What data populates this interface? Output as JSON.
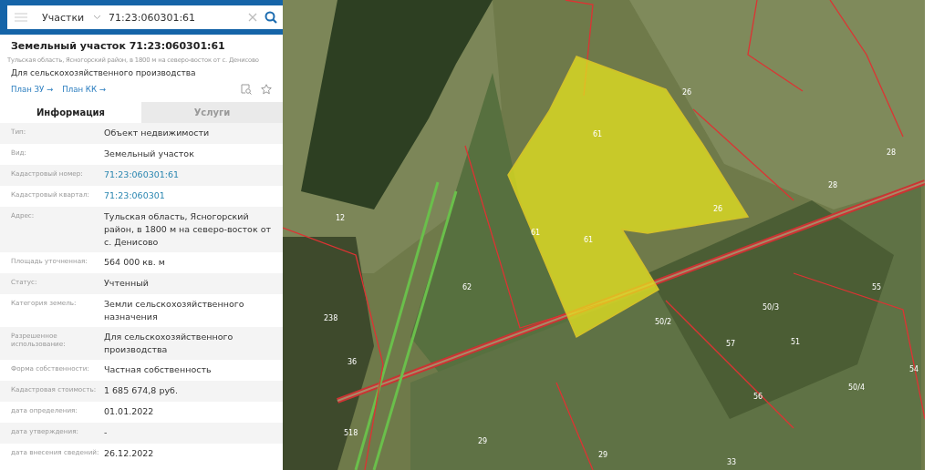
{
  "search": {
    "layer": "Участки",
    "query": "71:23:060301:61"
  },
  "card": {
    "title": "Земельный участок 71:23:060301:61",
    "address": "Тульская область, Ясногорский район, в 1800 м на северо-восток от с. Денисово",
    "purpose": "Для сельскохозяйственного производства",
    "links": [
      "План ЗУ →",
      "План КК →"
    ]
  },
  "tabs": [
    {
      "label": "Информация",
      "selected": true
    },
    {
      "label": "Услуги",
      "selected": false
    }
  ],
  "rows": [
    {
      "label": "Тип:",
      "value": "Объект недвижимости",
      "kind": "text"
    },
    {
      "label": "Вид:",
      "value": "Земельный участок",
      "kind": "text"
    },
    {
      "label": "Кадастровый номер:",
      "value": "71:23:060301:61",
      "kind": "link"
    },
    {
      "label": "Кадастровый квартал:",
      "value": "71:23:060301",
      "kind": "link"
    },
    {
      "label": "Адрес:",
      "value": "Тульская область, Ясногорский район, в 1800 м на северо-восток от с. Денисово",
      "kind": "text"
    },
    {
      "label": "Площадь уточненная:",
      "value": "564 000 кв. м",
      "kind": "text"
    },
    {
      "label": "Статус:",
      "value": "Учтенный",
      "kind": "text"
    },
    {
      "label": "Категория земель:",
      "value": "Земли сельскохозяйственного назначения",
      "kind": "text"
    },
    {
      "label": "Разрешенное использование:",
      "value": "Для сельскохозяйственного производства",
      "kind": "text"
    },
    {
      "label": "Форма собственности:",
      "value": "Частная собственность",
      "kind": "text"
    },
    {
      "label": "Кадастровая стоимость:",
      "value": "1 685 674,8 руб.",
      "kind": "text"
    },
    {
      "label": "дата определения:",
      "value": "01.01.2022",
      "kind": "text"
    },
    {
      "label": "дата утверждения:",
      "value": "-",
      "kind": "text"
    },
    {
      "label": "дата внесения сведений:",
      "value": "26.12.2022",
      "kind": "text"
    }
  ],
  "map": {
    "labels": [
      "61",
      "61",
      "61",
      "26",
      "28",
      "28",
      "26",
      "12",
      "62",
      "238",
      "36",
      "50/2",
      "55",
      "57",
      "51",
      "50/3",
      "54",
      "56",
      "50/4",
      "518",
      "29",
      "29",
      "33"
    ]
  }
}
